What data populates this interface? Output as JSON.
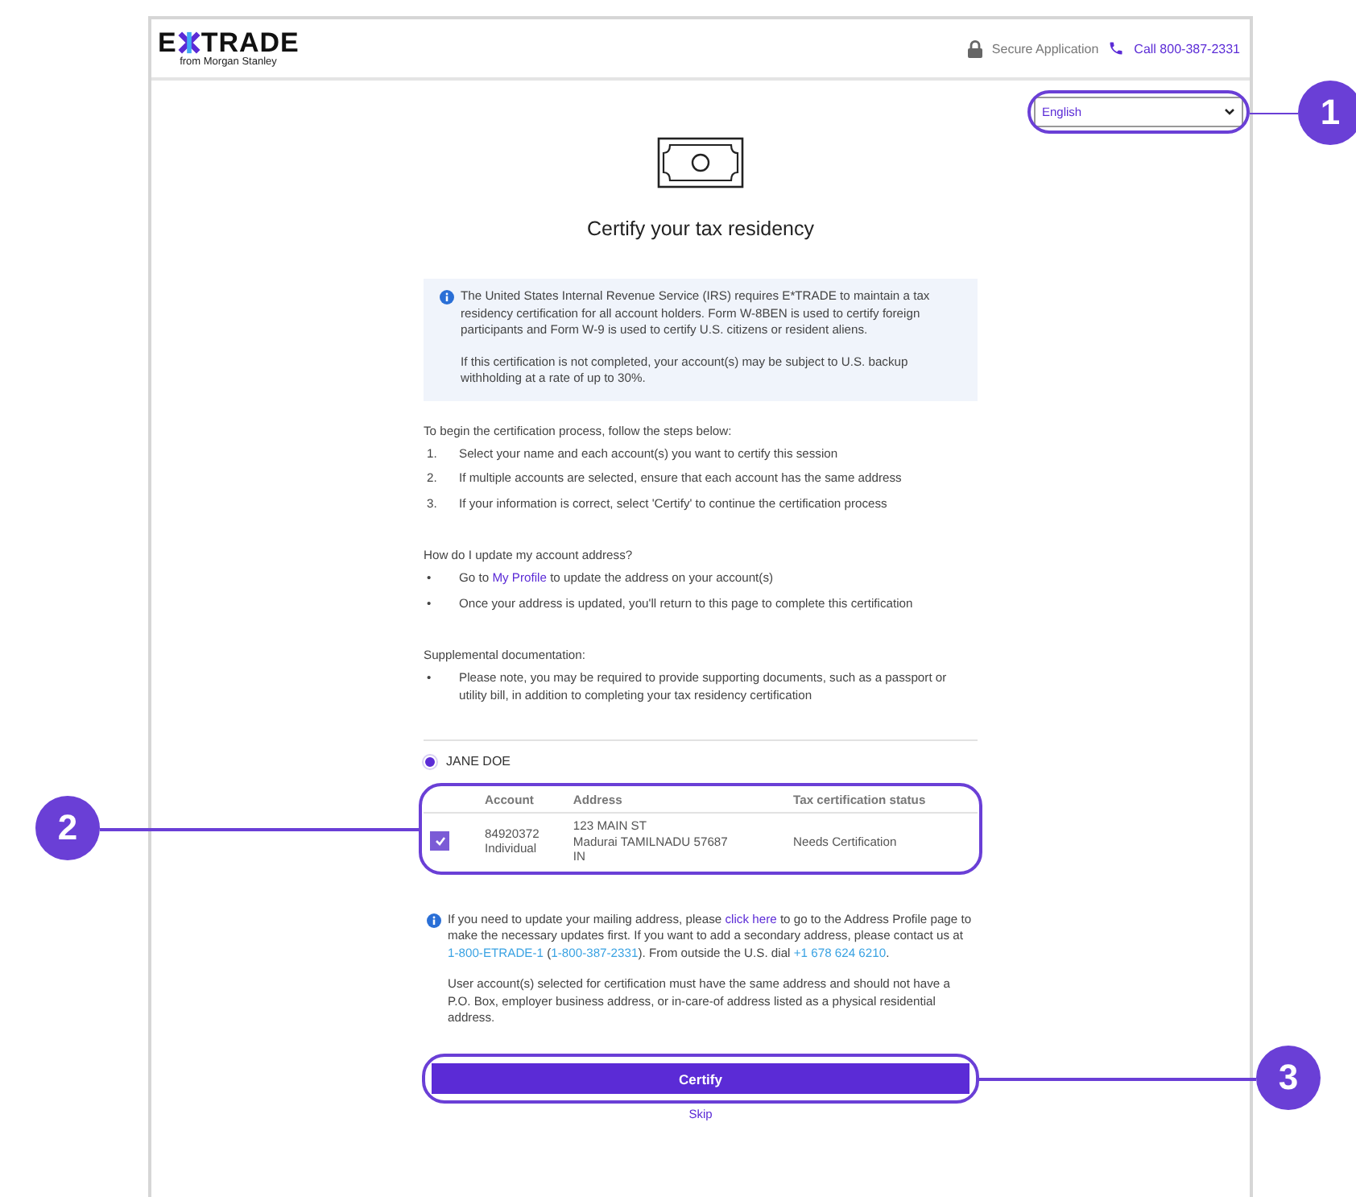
{
  "header": {
    "logo": {
      "letter": "E",
      "word": "TRADE",
      "tagline": "from Morgan Stanley"
    },
    "secure_label": "Secure Application",
    "call_link": "Call 800-387-2331"
  },
  "language_select": {
    "value": "English"
  },
  "title": "Certify your tax residency",
  "info_box": {
    "paragraphs": [
      "The United States Internal Revenue Service (IRS) requires E*TRADE to maintain a tax residency certification for all account holders. Form W-8BEN is used to certify foreign participants and Form W-9 is used to certify U.S. citizens or resident aliens.",
      "If this certification is not completed, your account(s) may be subject to U.S. backup withholding at a rate of up to 30%."
    ]
  },
  "steps": {
    "heading": "To begin the certification process, follow the steps below:",
    "items": [
      {
        "marker": "1.",
        "parts": [
          {
            "text": "Select your name and each account(s) you want to certify this session"
          }
        ]
      },
      {
        "marker": "2.",
        "parts": [
          {
            "text": "If multiple accounts are selected, ensure that each account has the same address"
          }
        ]
      },
      {
        "marker": "3.",
        "parts": [
          {
            "text": "If your information is correct, select 'Certify' to continue the certification process"
          }
        ]
      }
    ]
  },
  "address_help": {
    "heading": "How do I update my account address?",
    "items": [
      {
        "marker": "•",
        "parts": [
          {
            "text": "Go to "
          },
          {
            "text": "My Profile",
            "link": true
          },
          {
            "text": " to update the address on your account(s)"
          }
        ]
      },
      {
        "marker": "•",
        "parts": [
          {
            "text": "Once your address is updated, you'll return to this page to complete this certification"
          }
        ]
      }
    ]
  },
  "supplemental": {
    "heading": "Supplemental documentation:",
    "items": [
      {
        "marker": "•",
        "parts": [
          {
            "text": "Please note, you may be required to provide supporting documents, such as a passport or utility bill, in addition to completing your tax residency certification"
          }
        ]
      }
    ]
  },
  "account_holder": {
    "name": "JANE DOE",
    "selected": true
  },
  "accounts_table": {
    "columns": [
      "Account",
      "Address",
      "Tax certification status"
    ],
    "rows": [
      {
        "checked": true,
        "account": [
          "84920372",
          "Individual"
        ],
        "address": [
          "123 MAIN ST",
          "Madurai TAMILNADU 57687",
          "IN"
        ],
        "status": "Needs Certification"
      }
    ]
  },
  "notice": {
    "paragraphs": [
      {
        "parts": [
          {
            "text": "If you need to update your mailing address, please "
          },
          {
            "text": "click here",
            "link": true
          },
          {
            "text": " to go to the Address Profile page to make the necessary updates first. If you want to add a secondary address, please contact us at "
          },
          {
            "text": "1-800-ETRADE-1",
            "link": true
          },
          {
            "text": " ("
          },
          {
            "text": "1-800-387-2331",
            "link": true
          },
          {
            "text": "). From outside the U.S. dial "
          },
          {
            "text": "+1 678 624 6210",
            "link": true
          },
          {
            "text": "."
          }
        ]
      },
      {
        "parts": [
          {
            "text": "User account(s) selected for certification must have the same address and should not have a P.O. Box, employer business address, or in-care-of address listed as a physical residential address."
          }
        ]
      }
    ]
  },
  "certify_button": "Certify",
  "skip_link": "Skip",
  "callouts": [
    {
      "number": "1"
    },
    {
      "number": "2"
    },
    {
      "number": "3"
    }
  ]
}
